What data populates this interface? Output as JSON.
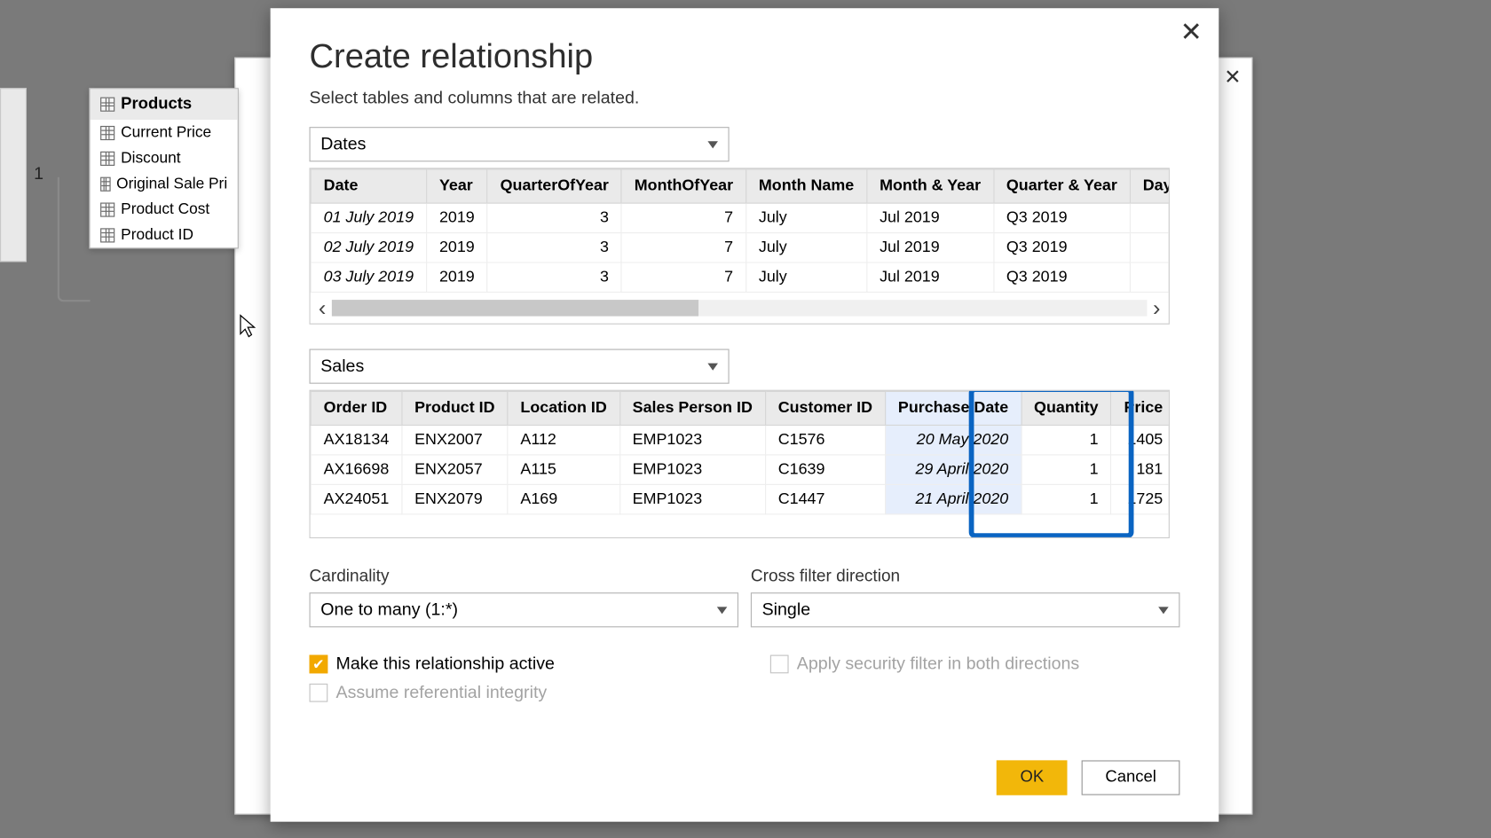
{
  "background_window": {
    "close_tooltip": "Close"
  },
  "field_panel": {
    "card_title": "Products",
    "fields": [
      "Current Price",
      "Discount",
      "Original Sale Pri",
      "Product Cost",
      "Product ID"
    ],
    "connector_label": "1"
  },
  "dialog": {
    "title": "Create relationship",
    "subtitle": "Select tables and columns that are related.",
    "table1_select": "Dates",
    "table2_select": "Sales",
    "dates_columns": [
      "Date",
      "Year",
      "QuarterOfYear",
      "MonthOfYear",
      "Month Name",
      "Month & Year",
      "Quarter & Year",
      "DayInW"
    ],
    "dates_rows": [
      {
        "Date": "01 July 2019",
        "Year": "2019",
        "QuarterOfYear": "3",
        "MonthOfYear": "7",
        "MonthName": "July",
        "MonthYear": "Jul 2019",
        "QuarterYear": "Q3 2019",
        "DayInW": ""
      },
      {
        "Date": "02 July 2019",
        "Year": "2019",
        "QuarterOfYear": "3",
        "MonthOfYear": "7",
        "MonthName": "July",
        "MonthYear": "Jul 2019",
        "QuarterYear": "Q3 2019",
        "DayInW": ""
      },
      {
        "Date": "03 July 2019",
        "Year": "2019",
        "QuarterOfYear": "3",
        "MonthOfYear": "7",
        "MonthName": "July",
        "MonthYear": "Jul 2019",
        "QuarterYear": "Q3 2019",
        "DayInW": ""
      }
    ],
    "sales_columns": [
      "Order ID",
      "Product ID",
      "Location ID",
      "Sales Person ID",
      "Customer ID",
      "Purchase Date",
      "Quantity",
      "Price"
    ],
    "sales_selected_column": "Purchase Date",
    "sales_rows": [
      {
        "OrderID": "AX18134",
        "ProductID": "ENX2007",
        "LocationID": "A112",
        "SalesPersonID": "EMP1023",
        "CustomerID": "C1576",
        "PurchaseDate": "20 May 2020",
        "Quantity": "1",
        "Price": "1405"
      },
      {
        "OrderID": "AX16698",
        "ProductID": "ENX2057",
        "LocationID": "A115",
        "SalesPersonID": "EMP1023",
        "CustomerID": "C1639",
        "PurchaseDate": "29 April 2020",
        "Quantity": "1",
        "Price": "181"
      },
      {
        "OrderID": "AX24051",
        "ProductID": "ENX2079",
        "LocationID": "A169",
        "SalesPersonID": "EMP1023",
        "CustomerID": "C1447",
        "PurchaseDate": "21 April 2020",
        "Quantity": "1",
        "Price": "1725"
      }
    ],
    "cardinality_label": "Cardinality",
    "cardinality_value": "One to many (1:*)",
    "crossfilter_label": "Cross filter direction",
    "crossfilter_value": "Single",
    "check_active": "Make this relationship active",
    "check_security": "Apply security filter in both directions",
    "check_referential": "Assume referential integrity",
    "btn_ok": "OK",
    "btn_cancel": "Cancel"
  }
}
